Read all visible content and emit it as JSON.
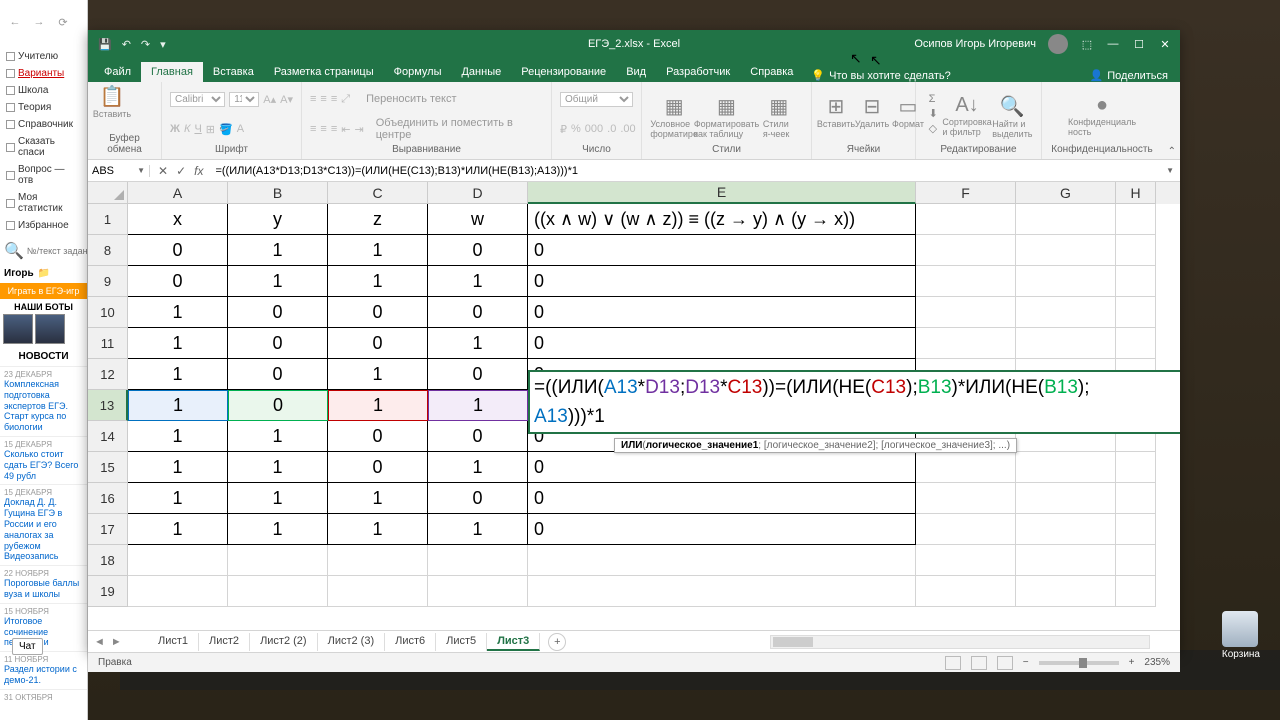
{
  "browser": {
    "sidebar": [
      "Учителю",
      "Варианты",
      "Школа",
      "Теория",
      "Справочник",
      "Сказать спаси",
      "Вопрос — отв",
      "Моя статистик",
      "Избранное"
    ],
    "search_placeholder": "№/текст задани",
    "user": "Игорь",
    "play": "Играть в ЕГЭ-игр",
    "bots": "НАШИ БОТЫ",
    "news_title": "НОВОСТИ",
    "news": [
      {
        "date": "23 ДЕКАБРЯ",
        "text": "Комплексная подготовка экспертов ЕГЭ. Старт курса по биологии"
      },
      {
        "date": "15 ДЕКАБРЯ",
        "text": "Сколько стоит сдать ЕГЭ? Всего 49 рубл"
      },
      {
        "date": "15 ДЕКАБРЯ",
        "text": "Доклад Д. Д. Гущина ЕГЭ в России и его аналогах за рубежом Видеозапись"
      },
      {
        "date": "22 НОЯБРЯ",
        "text": "Пороговые баллы вуза и школы"
      },
      {
        "date": "15 НОЯБРЯ",
        "text": "Итоговое сочинение перенесли"
      },
      {
        "date": "11 НОЯБРЯ",
        "text": "Раздел истории с демо-21."
      },
      {
        "date": "31 ОКТЯБРЯ",
        "text": ""
      }
    ],
    "chat": "Чат"
  },
  "excel": {
    "title": "ЕГЭ_2.xlsx - Excel",
    "user": "Осипов Игорь Игоревич",
    "tabs": [
      "Файл",
      "Главная",
      "Вставка",
      "Разметка страницы",
      "Формулы",
      "Данные",
      "Рецензирование",
      "Вид",
      "Разработчик",
      "Справка"
    ],
    "tellme": "Что вы хотите сделать?",
    "share": "Поделиться",
    "ribbon_groups": [
      "Буфер обмена",
      "Шрифт",
      "Выравнивание",
      "Число",
      "Стили",
      "Ячейки",
      "Редактирование",
      "Конфиденциальность"
    ],
    "paste": "Вставить",
    "font": "Calibri",
    "size": "11",
    "wrap": "Переносить текст",
    "merge": "Объединить и поместить в центре",
    "numfmt": "Общий",
    "cond": "Условное форматиро",
    "table": "Форматировать как таблицу",
    "styles": "Стили я-чеек",
    "ins": "Вставить",
    "del": "Удалить",
    "fmt": "Формат",
    "sort": "Сортировка и фильтр",
    "find": "Найти и выделить",
    "conf": "Конфиденциаль ность",
    "name_box": "ABS",
    "formula": "=((ИЛИ(A13*D13;D13*C13))=(ИЛИ(НЕ(C13);B13)*ИЛИ(НЕ(B13);A13)))*1",
    "tooltip": "ИЛИ(логическое_значение1; [логическое_значение2]; [логическое_значение3]; ...)",
    "columns": [
      "A",
      "B",
      "C",
      "D",
      "E",
      "F",
      "G",
      "H"
    ],
    "header_row": [
      "x",
      "y",
      "z",
      "w",
      "((x ∧ w) ∨ (w ∧ z)) ≡ ((z → y) ∧ (y → x))"
    ],
    "rows": [
      {
        "n": "8",
        "v": [
          "0",
          "1",
          "1",
          "0",
          "0"
        ]
      },
      {
        "n": "9",
        "v": [
          "0",
          "1",
          "1",
          "1",
          "0"
        ]
      },
      {
        "n": "10",
        "v": [
          "1",
          "0",
          "0",
          "0",
          "0"
        ]
      },
      {
        "n": "11",
        "v": [
          "1",
          "0",
          "0",
          "1",
          "0"
        ]
      },
      {
        "n": "12",
        "v": [
          "1",
          "0",
          "1",
          "0",
          "0"
        ]
      },
      {
        "n": "13",
        "v": [
          "1",
          "0",
          "1",
          "1",
          ""
        ]
      },
      {
        "n": "14",
        "v": [
          "1",
          "1",
          "0",
          "0",
          "0"
        ]
      },
      {
        "n": "15",
        "v": [
          "1",
          "1",
          "0",
          "1",
          "0"
        ]
      },
      {
        "n": "16",
        "v": [
          "1",
          "1",
          "1",
          "0",
          "0"
        ]
      },
      {
        "n": "17",
        "v": [
          "1",
          "1",
          "1",
          "1",
          "0"
        ]
      },
      {
        "n": "18",
        "v": [
          "",
          "",
          "",
          "",
          ""
        ]
      },
      {
        "n": "19",
        "v": [
          "",
          "",
          "",
          "",
          ""
        ]
      }
    ],
    "edit_formula": {
      "pre": "=((ИЛИ(",
      "a1": "A13",
      "m1": "*",
      "d1": "D13",
      "s1": ";",
      "d2": "D13",
      "m2": "*",
      "c1": "C13",
      "p1": "))=(ИЛИ(НЕ(",
      "c2": "C13",
      "p2": ");",
      "b1": "B13",
      "p3": ")*ИЛИ(НЕ(",
      "b2": "B13",
      "p4": ");",
      "a2": "A13",
      "p5": ")))*1"
    },
    "sheets": [
      "Лист1",
      "Лист2",
      "Лист2 (2)",
      "Лист2 (3)",
      "Лист6",
      "Лист5",
      "Лист3"
    ],
    "status": "Правка",
    "zoom": "235%"
  },
  "trash": "Корзина"
}
